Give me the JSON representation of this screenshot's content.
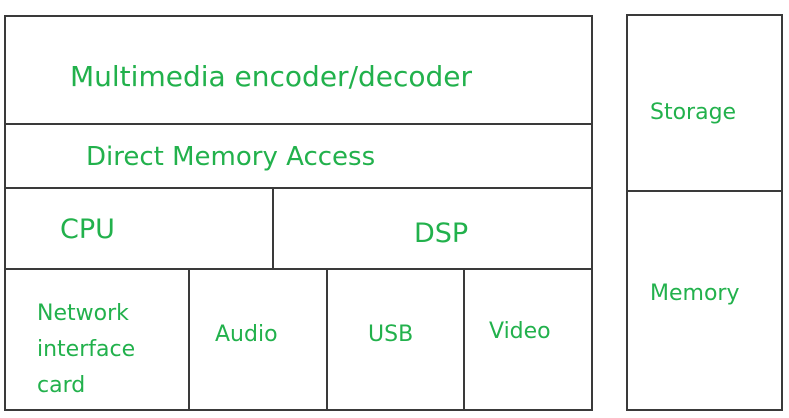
{
  "diagram": {
    "text_color": "#22b14c",
    "border_color": "#3a3a3a",
    "main_block": {
      "encoder": "Multimedia encoder/decoder",
      "dma": "Direct Memory Access",
      "cpu": "CPU",
      "dsp": "DSP",
      "nic": "Network interface card",
      "audio": "Audio",
      "usb": "USB",
      "video": "Video"
    },
    "side_block": {
      "storage": "Storage",
      "memory": "Memory"
    }
  }
}
